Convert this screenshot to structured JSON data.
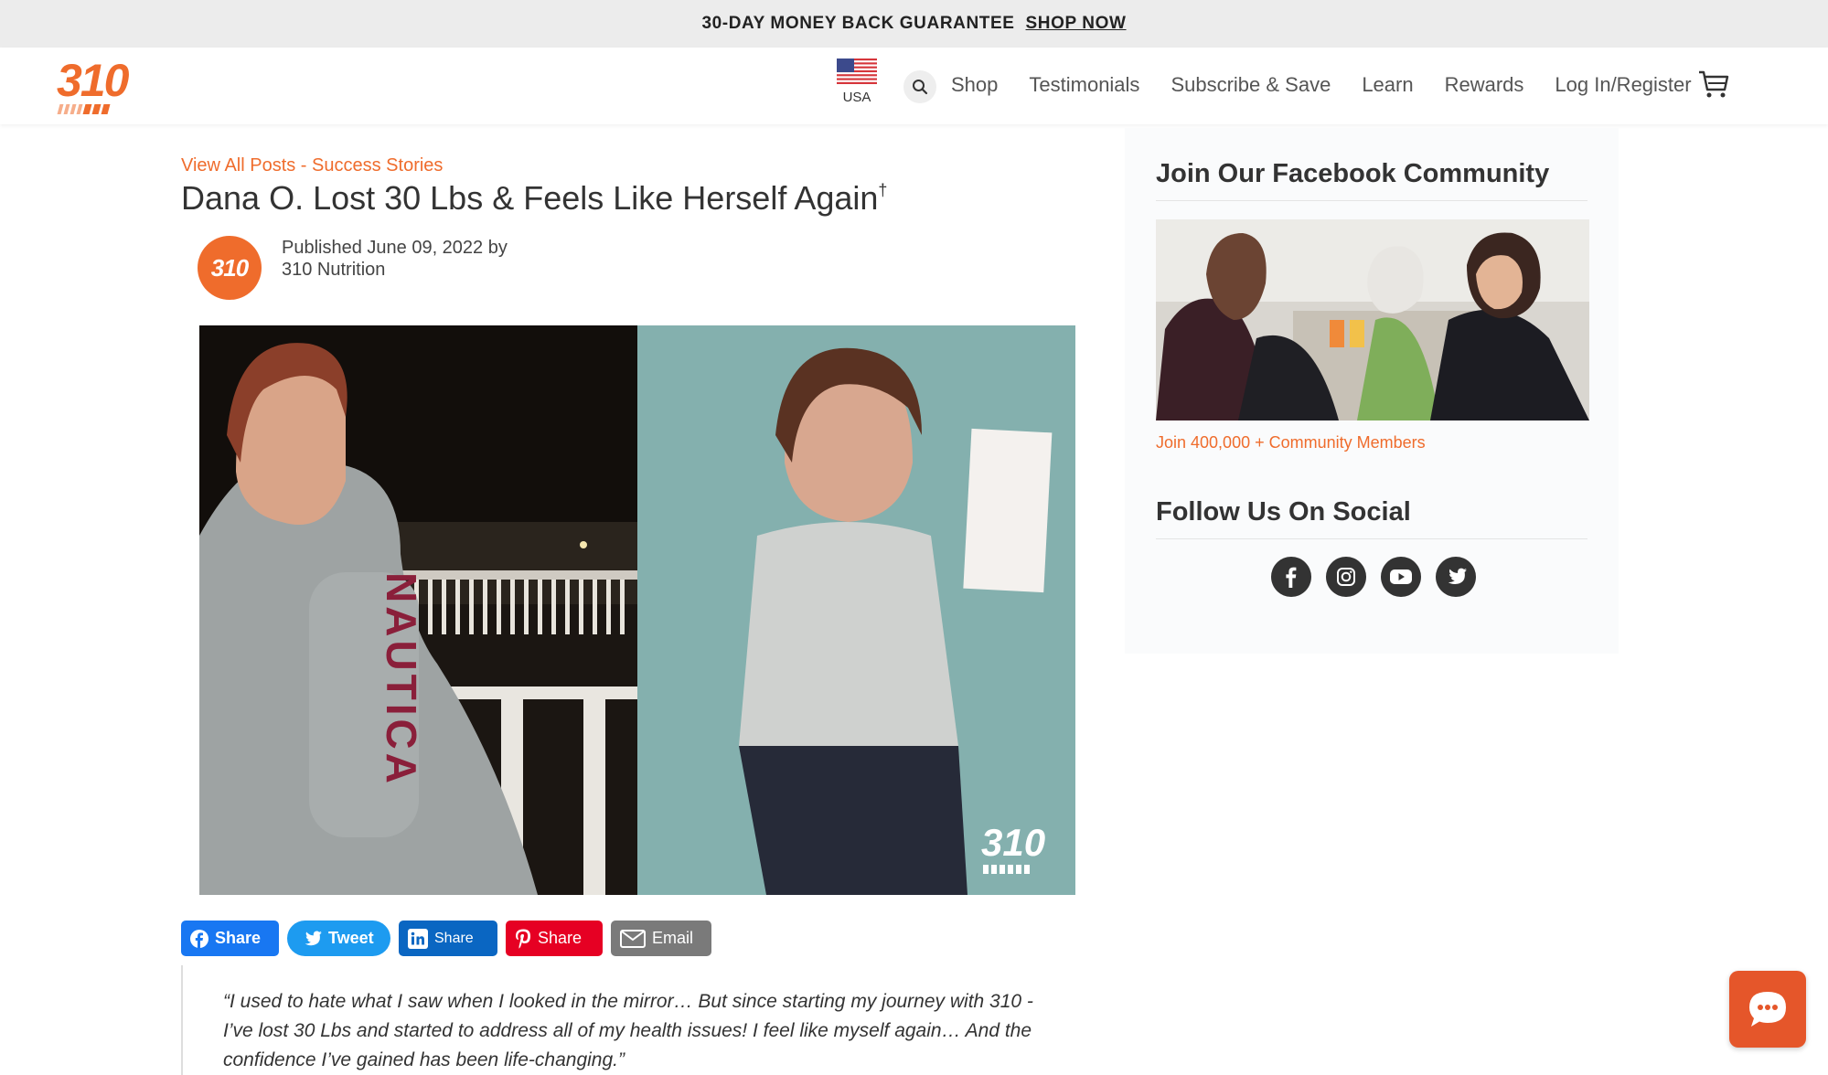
{
  "promo": {
    "text": "30-DAY MONEY BACK GUARANTEE",
    "cta": "SHOP NOW"
  },
  "header": {
    "logo": "310",
    "region": "USA",
    "nav": [
      "Shop",
      "Testimonials",
      "Subscribe & Save",
      "Learn",
      "Rewards",
      "Log In/Register"
    ]
  },
  "article": {
    "breadcrumb": {
      "all_posts": "View All Posts",
      "separator": " - ",
      "category": "Success Stories"
    },
    "title": "Dana O. Lost 30 Lbs & Feels Like Herself Again",
    "title_mark": "†",
    "author_avatar": "310",
    "published_line": "Published June 09, 2022 by",
    "author": "310 Nutrition",
    "hero_text": {
      "sweatshirt": "NAUTICA",
      "watermark": "310"
    },
    "share_buttons": [
      "Share",
      "Tweet",
      "Share",
      "Share",
      "Email"
    ],
    "quote_lines": [
      "“I used to hate what I saw when I looked in the mirror… But since starting my journey with 310 -",
      "I’ve lost 30 Lbs and started to address all of my health issues! I feel like myself again… And the",
      "confidence I’ve gained has been life-changing.”"
    ]
  },
  "sidebar": {
    "facebook_heading": "Join Our Facebook Community",
    "join_link": "Join 400,000 + Community Members",
    "social_heading": "Follow Us On Social",
    "social_icons": [
      "facebook-icon",
      "instagram-icon",
      "youtube-icon",
      "twitter-icon"
    ]
  },
  "colors": {
    "brand": "#ef6c2c",
    "facebook": "#1877f2",
    "twitter": "#1d9bf0",
    "linkedin": "#0a66c2",
    "pinterest": "#e60023",
    "email": "#7a7a7a",
    "chat": "#e5562a"
  }
}
